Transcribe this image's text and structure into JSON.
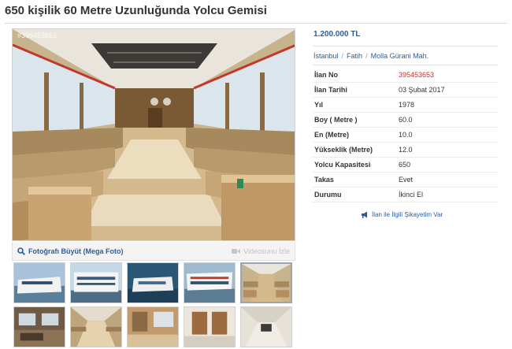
{
  "listing": {
    "title": "650 kişilik 60 Metre Uzunluğunda Yolcu Gemisi",
    "price": "1.200.000 TL",
    "photo_id": "#395453653"
  },
  "location": [
    "İstanbul",
    "Fatih",
    "Molla Gürani Mah."
  ],
  "location_separator": "/",
  "details": [
    {
      "label": "İlan No",
      "value": "395453653"
    },
    {
      "label": "İlan Tarihi",
      "value": "03 Şubat 2017"
    },
    {
      "label": "Yıl",
      "value": "1978"
    },
    {
      "label": "Boy ( Metre )",
      "value": "60.0"
    },
    {
      "label": "En (Metre)",
      "value": "10.0"
    },
    {
      "label": "Yükseklik (Metre)",
      "value": "12.0"
    },
    {
      "label": "Yolcu Kapasitesi",
      "value": "650"
    },
    {
      "label": "Takas",
      "value": "Evet"
    },
    {
      "label": "Durumu",
      "value": "İkinci El"
    }
  ],
  "gallery": {
    "enlarge_label": "Fotoğrafı Büyüt (Mega Foto)",
    "video_label": "Videosunu İzle",
    "enlarge_icon": "magnifier-icon",
    "video_icon": "video-camera-icon",
    "active_thumb": 5
  },
  "complaint_label": "İlan ile İlgili Şikayetim Var",
  "complaint_icon": "megaphone-icon",
  "colors": {
    "link_blue": "#2a5d9f",
    "listing_no_red": "#c0322b",
    "title_gray": "#333333"
  }
}
